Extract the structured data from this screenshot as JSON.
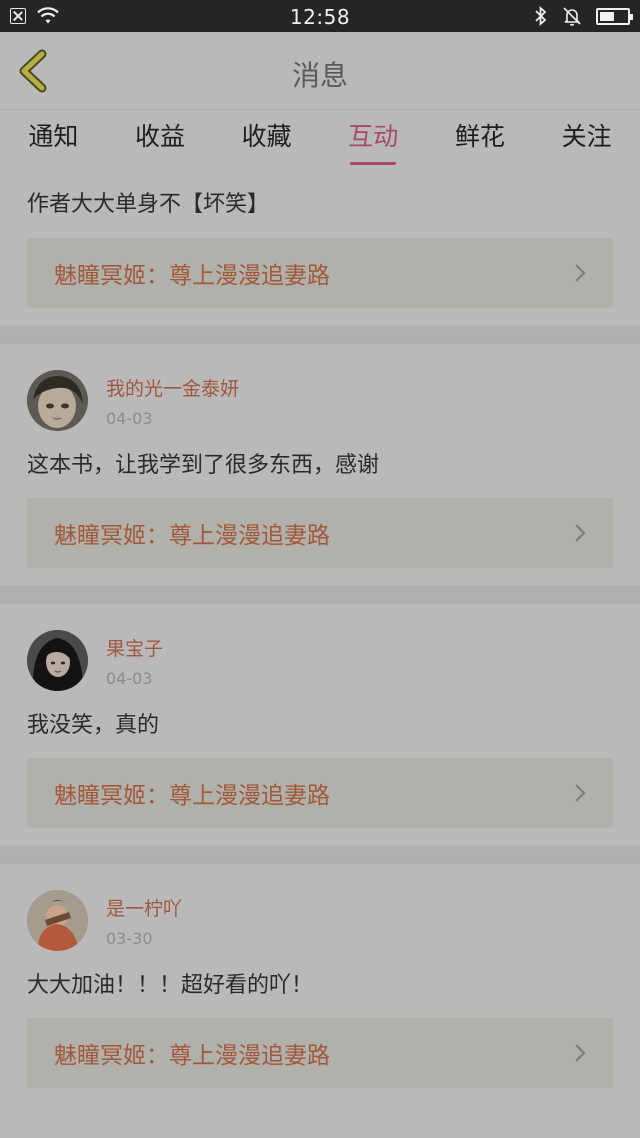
{
  "status_bar": {
    "time": "12:58"
  },
  "header": {
    "title": "消息",
    "back_icon": "chevron-left-icon"
  },
  "tabs": [
    {
      "label": "通知",
      "active": false
    },
    {
      "label": "收益",
      "active": false
    },
    {
      "label": "收藏",
      "active": false
    },
    {
      "label": "互动",
      "active": true
    },
    {
      "label": "鲜花",
      "active": false
    },
    {
      "label": "关注",
      "active": false
    }
  ],
  "colors": {
    "accent": "#a64a68",
    "link_text": "#a4583a",
    "username": "#a0583e"
  },
  "messages": [
    {
      "comment": "作者大大单身不【坏笑】",
      "book": "魅瞳冥姬：尊上漫漫追妻路"
    },
    {
      "username": "我的光一金泰妍",
      "date": "04-03",
      "comment": "这本书，让我学到了很多东西，感谢",
      "book": "魅瞳冥姬：尊上漫漫追妻路"
    },
    {
      "username": "果宝子",
      "date": "04-03",
      "comment": "我没笑，真的",
      "book": "魅瞳冥姬：尊上漫漫追妻路"
    },
    {
      "username": "是一柠吖",
      "date": "03-30",
      "comment": "大大加油！！！超好看的吖！",
      "book": "魅瞳冥姬：尊上漫漫追妻路"
    }
  ]
}
